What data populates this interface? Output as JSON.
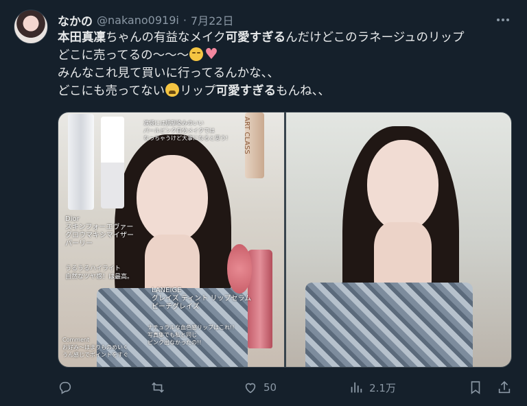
{
  "tweet": {
    "author_name": "なかの",
    "handle": "@nakano0919i",
    "separator": "·",
    "date": "7月22日",
    "lines": [
      {
        "parts": [
          {
            "t": "本田真凜",
            "b": true
          },
          {
            "t": "ちゃんの有益なメイク",
            "b": false
          },
          {
            "t": "可愛すぎる",
            "b": true
          },
          {
            "t": "んだけどこのラネージュのリップ",
            "b": false
          }
        ]
      },
      {
        "parts": [
          {
            "t": "どこに売ってるの〜〜〜",
            "b": false
          }
        ],
        "emoji": [
          "relieved-face-emoji",
          "pink-heart-emoji"
        ]
      },
      {
        "parts": [
          {
            "t": "みんなこれ見て買いに行ってるんかな、、",
            "b": false
          }
        ]
      },
      {
        "parts": [
          {
            "t": "どこにも売ってない",
            "b": false
          }
        ],
        "emoji_after_first": "tired-face-emoji",
        "parts_after": [
          {
            "t": "リップ",
            "b": false
          },
          {
            "t": "可愛すぎる",
            "b": true
          },
          {
            "t": "もんね、、",
            "b": false
          }
        ]
      }
    ]
  },
  "media": {
    "left_photo_notes": {
      "top_note": "涙袋には肌馴染みのいい\nパールピンク自分メイクでは\nなっちゃうけど大事になると思う!",
      "art_class": "ART CLASS",
      "dior": "Dior\nスキンフォーエヴァー\nグロウマキシマイザー\nパーリー",
      "highlight": "うるうるハイライト\n自然なツヤ感！は最高。",
      "laneige": "LANEIGE\nグレイズ ティント リップセラム\nピーチグレイズ",
      "natural": "ナチュラルな血色感リップはこれ!!\n写真集でも私と同じ\nピンク出なかったの!!",
      "comment": "Comment\nお好み〜はまりものめいく\nうん感じでポイントをすぐ"
    }
  },
  "actions": {
    "reply_count": "",
    "retweet_count": "",
    "like_count": "50",
    "views_count": "2.1万"
  },
  "colors": {
    "background": "#15202b",
    "text": "#e7e9ea",
    "secondary": "#8b98a5",
    "border": "#38444d"
  }
}
